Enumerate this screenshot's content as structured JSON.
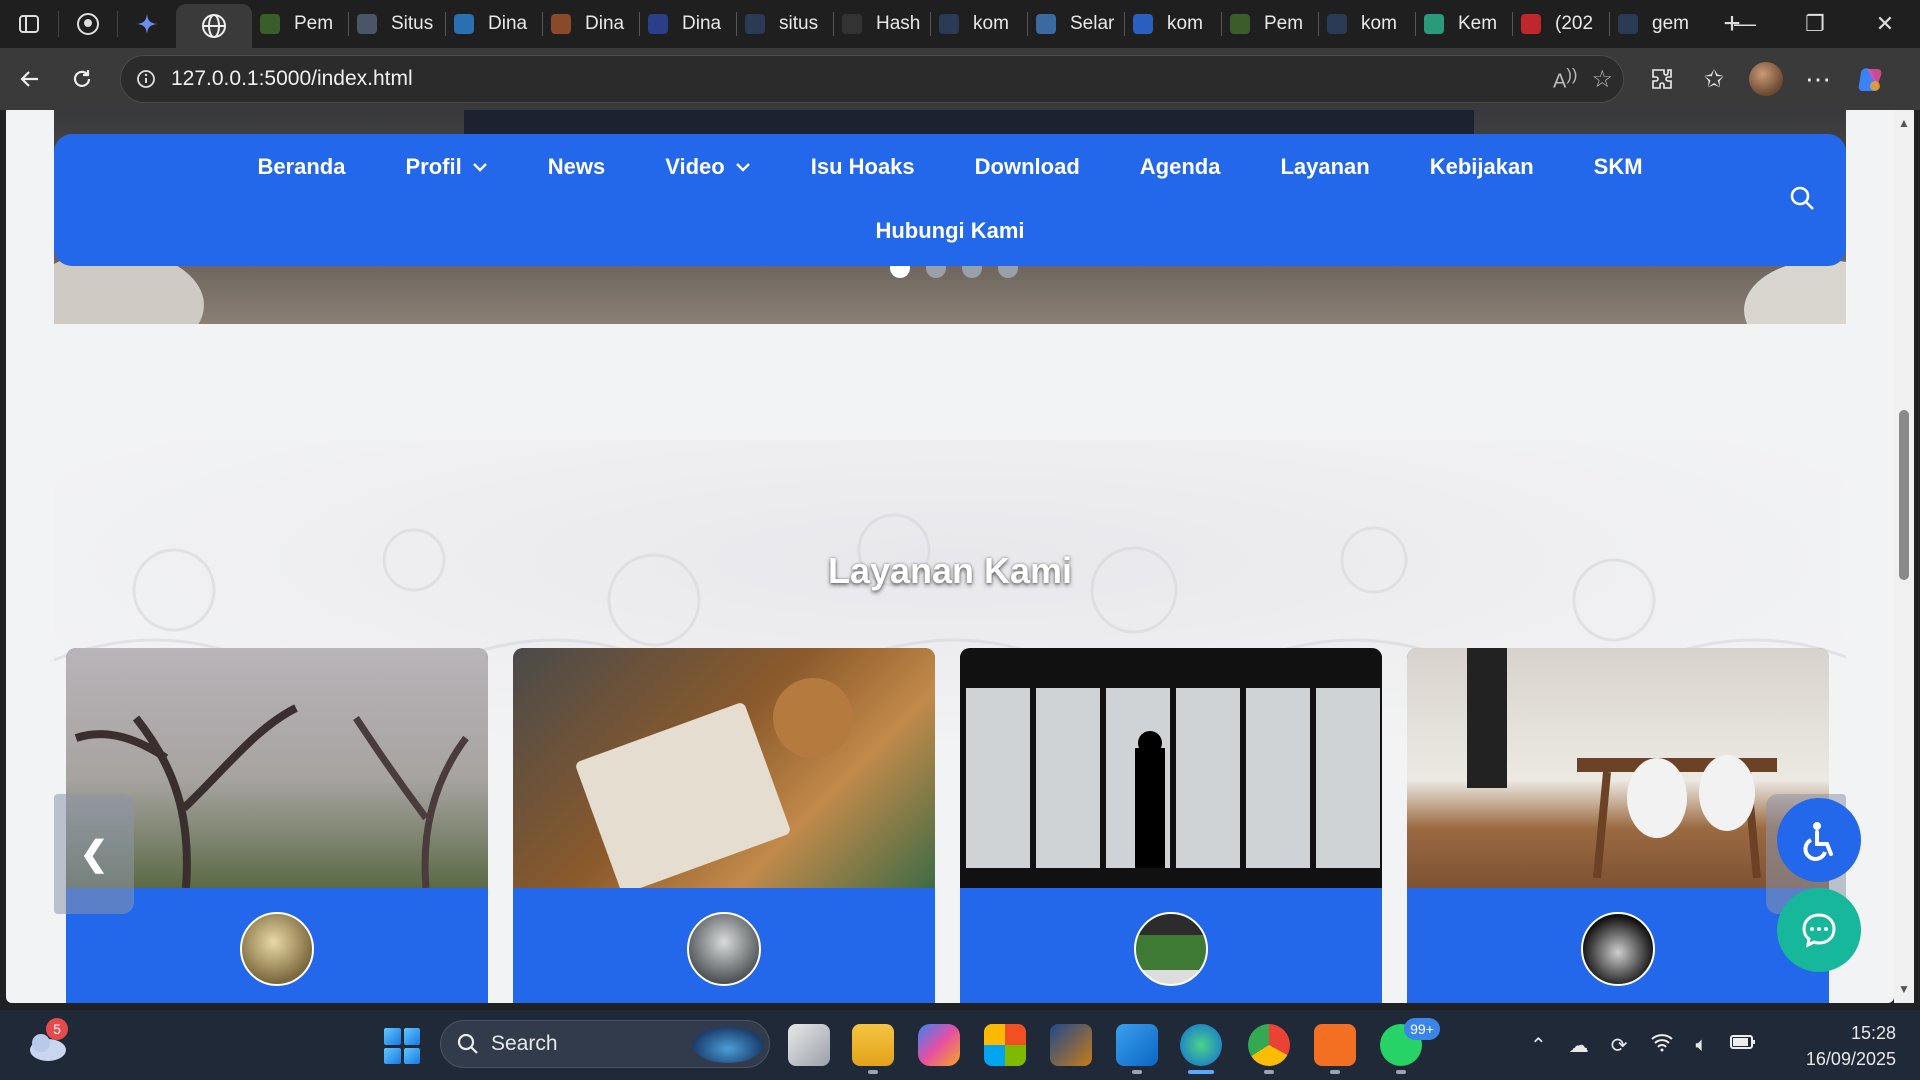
{
  "browser": {
    "tabs": [
      {
        "label": "Pem",
        "color": "#3b5d2a"
      },
      {
        "label": "Situs",
        "color": "#4a5568"
      },
      {
        "label": "Dina",
        "color": "#2a6fb0"
      },
      {
        "label": "Dina",
        "color": "#8a4a2a"
      },
      {
        "label": "Dina",
        "color": "#2a3e8a"
      },
      {
        "label": "situs",
        "color": "#2b3b55"
      },
      {
        "label": "Hash",
        "color": "#333333"
      },
      {
        "label": "kom",
        "color": "#2b3b55"
      },
      {
        "label": "Selar",
        "color": "#3a6aa0"
      },
      {
        "label": "kom",
        "color": "#2a5fc0"
      },
      {
        "label": "Pem",
        "color": "#3b5d2a"
      },
      {
        "label": "kom",
        "color": "#2b3b55"
      },
      {
        "label": "Kem",
        "color": "#2a9a7a"
      },
      {
        "label": "(202",
        "color": "#c0262d"
      },
      {
        "label": "gem",
        "color": "#2b3b55"
      }
    ],
    "url": "127.0.0.1:5000/index.html"
  },
  "nav": {
    "items": [
      {
        "label": "Beranda",
        "dropdown": false
      },
      {
        "label": "Profil",
        "dropdown": true
      },
      {
        "label": "News",
        "dropdown": false
      },
      {
        "label": "Video",
        "dropdown": true
      },
      {
        "label": "Isu Hoaks",
        "dropdown": false
      },
      {
        "label": "Download",
        "dropdown": false
      },
      {
        "label": "Agenda",
        "dropdown": false
      },
      {
        "label": "Layanan",
        "dropdown": false
      },
      {
        "label": "Kebijakan",
        "dropdown": false
      },
      {
        "label": "SKM",
        "dropdown": false
      }
    ],
    "second_row": "Hubungi Kami",
    "color": "#2367ea"
  },
  "hero": {
    "slide_count": 4,
    "active_slide": 1
  },
  "services": {
    "title": "Layanan Kami",
    "prev_label": "❮",
    "card_count": 4
  },
  "taskbar": {
    "weather_badge": "5",
    "search_label": "Search",
    "whatsapp_badge": "99+",
    "time": "15:28",
    "date": "16/09/2025"
  }
}
